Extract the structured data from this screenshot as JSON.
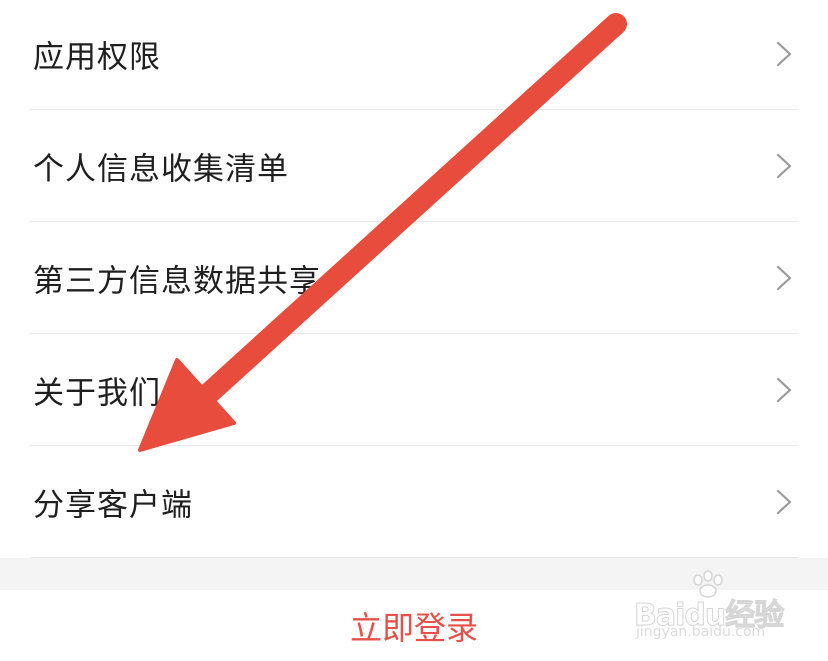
{
  "menu": {
    "items": [
      {
        "label": "应用权限"
      },
      {
        "label": "个人信息收集清单"
      },
      {
        "label": "第三方信息数据共享"
      },
      {
        "label": "关于我们"
      },
      {
        "label": "分享客户端"
      }
    ]
  },
  "login": {
    "label": "立即登录"
  },
  "watermark": {
    "brand": "Baidu经验",
    "url": "jingyan.baidu.com"
  },
  "colors": {
    "accent": "#e8504a",
    "annotation_arrow": "#e84c3d",
    "text": "#1f1f1f",
    "divider": "#e9e9e9",
    "chevron": "#9a9a9a",
    "gap_band": "#f4f4f4"
  },
  "icons": {
    "chevron": "chevron-right-icon",
    "annotation": "arrow-annotation-icon",
    "watermark_logo": "baidu-paw-icon"
  }
}
